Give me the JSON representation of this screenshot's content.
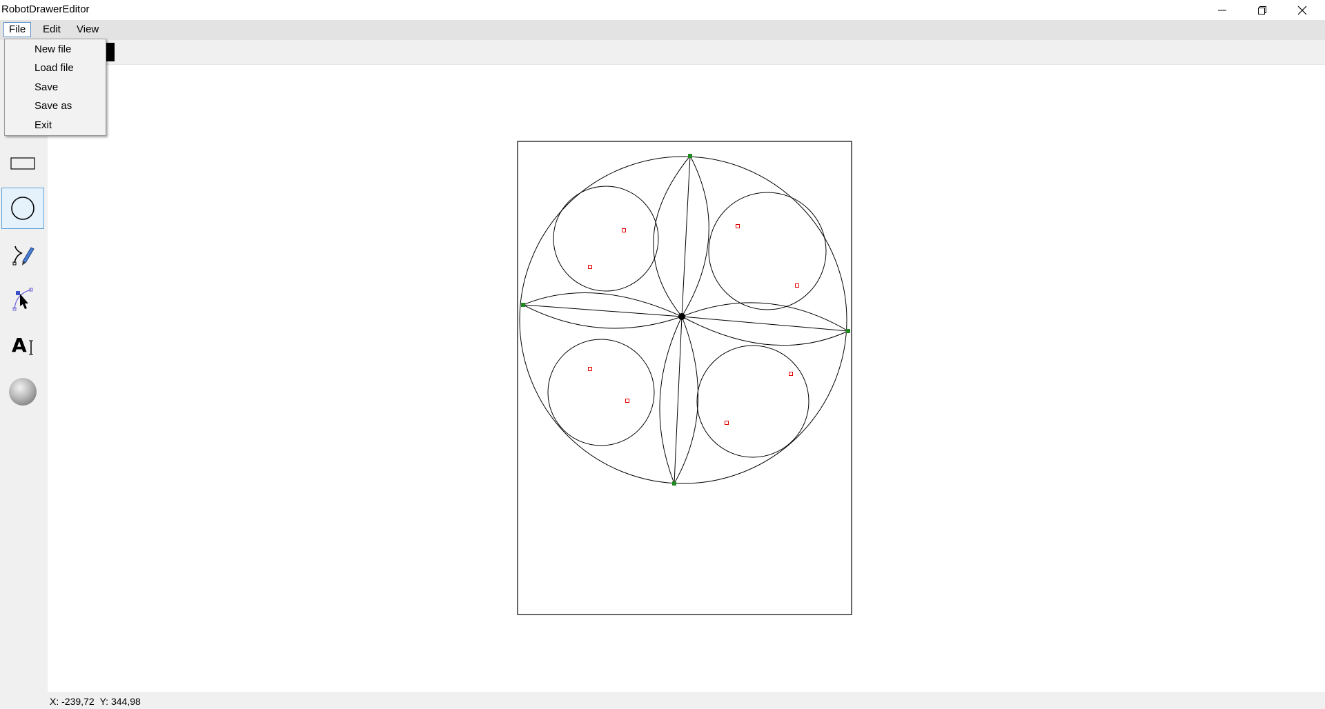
{
  "window": {
    "title": "RobotDrawerEditor",
    "minimize_icon": "minimize-icon",
    "maximize_icon": "restore-icon",
    "close_icon": "close-icon"
  },
  "menubar": {
    "items": [
      {
        "label": "File",
        "open": true
      },
      {
        "label": "Edit"
      },
      {
        "label": "View"
      }
    ]
  },
  "file_menu": {
    "items": [
      "New file",
      "Load file",
      "Save",
      "Save as",
      "Exit"
    ]
  },
  "tools": [
    {
      "name": "rectangle-tool",
      "icon": "rectangle-icon"
    },
    {
      "name": "ellipse-tool",
      "icon": "ellipse-icon",
      "selected": true
    },
    {
      "name": "freehand-tool",
      "icon": "pen-icon"
    },
    {
      "name": "bezier-tool",
      "icon": "bezier-icon"
    },
    {
      "name": "text-tool",
      "icon": "text-icon"
    },
    {
      "name": "fill-tool",
      "icon": "sphere-icon"
    }
  ],
  "status": {
    "x": "X: -239,72",
    "y": "Y: 344,98"
  },
  "colors": {
    "menubar": "#e3e3e3",
    "panel": "#f0f0f0",
    "selected_tool": "#e5f1fb",
    "control_point": "#e00000",
    "anchor_point": "#1f8a1f"
  }
}
